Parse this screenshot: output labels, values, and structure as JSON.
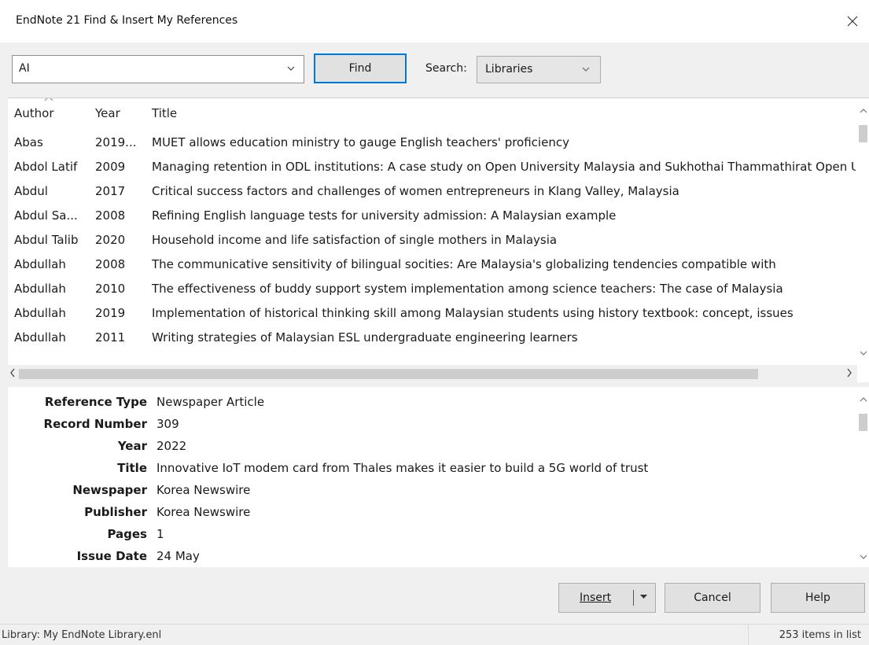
{
  "window": {
    "title": "EndNote 21 Find & Insert My References"
  },
  "toolbar": {
    "query_value": "AI",
    "find_label": "Find",
    "search_label": "Search:",
    "search_value": "Libraries"
  },
  "list": {
    "columns": [
      "Author",
      "Year",
      "Title"
    ],
    "rows": [
      {
        "author": "Abas",
        "year": "2019...",
        "title": "MUET allows education ministry to gauge English teachers' proficiency"
      },
      {
        "author": "Abdol Latif",
        "year": "2009",
        "title": "Managing retention in ODL institutions: A case study on Open University Malaysia and Sukhothai Thammathirat Open University"
      },
      {
        "author": "Abdul",
        "year": "2017",
        "title": "Critical success factors and challenges of women entrepreneurs in Klang Valley, Malaysia"
      },
      {
        "author": "Abdul Sa...",
        "year": "2008",
        "title": "Refining English language tests for university admission: A Malaysian example"
      },
      {
        "author": "Abdul Talib",
        "year": "2020",
        "title": "Household income and life satisfaction of single mothers in Malaysia"
      },
      {
        "author": "Abdullah",
        "year": "2008",
        "title": "The communicative sensitivity of bilingual socities: Are Malaysia's globalizing tendencies compatible with"
      },
      {
        "author": "Abdullah",
        "year": "2010",
        "title": "The effectiveness of buddy support system implementation among science teachers: The case of Malaysia"
      },
      {
        "author": "Abdullah",
        "year": "2019",
        "title": "Implementation of historical thinking skill among Malaysian students using history textbook: concept, issues"
      },
      {
        "author": "Abdullah",
        "year": "2011",
        "title": "Writing strategies of Malaysian ESL undergraduate engineering learners"
      }
    ]
  },
  "detail": {
    "fields": [
      {
        "label": "Reference Type",
        "value": "Newspaper Article"
      },
      {
        "label": "Record Number",
        "value": "309"
      },
      {
        "label": "Year",
        "value": "2022"
      },
      {
        "label": "Title",
        "value": "Innovative IoT modem card from Thales makes it easier to build a 5G world of trust"
      },
      {
        "label": "Newspaper",
        "value": "Korea Newswire"
      },
      {
        "label": "Publisher",
        "value": "Korea Newswire"
      },
      {
        "label": "Pages",
        "value": "1"
      },
      {
        "label": "Issue Date",
        "value": "24 May"
      }
    ]
  },
  "buttons": {
    "insert": "Insert",
    "cancel": "Cancel",
    "help": "Help"
  },
  "status": {
    "library": "Library: My EndNote Library.enl",
    "count": "253 items in list"
  },
  "colors": {
    "accent": "#0078d7",
    "background": "#f0f0f0",
    "pane": "#ffffff"
  }
}
